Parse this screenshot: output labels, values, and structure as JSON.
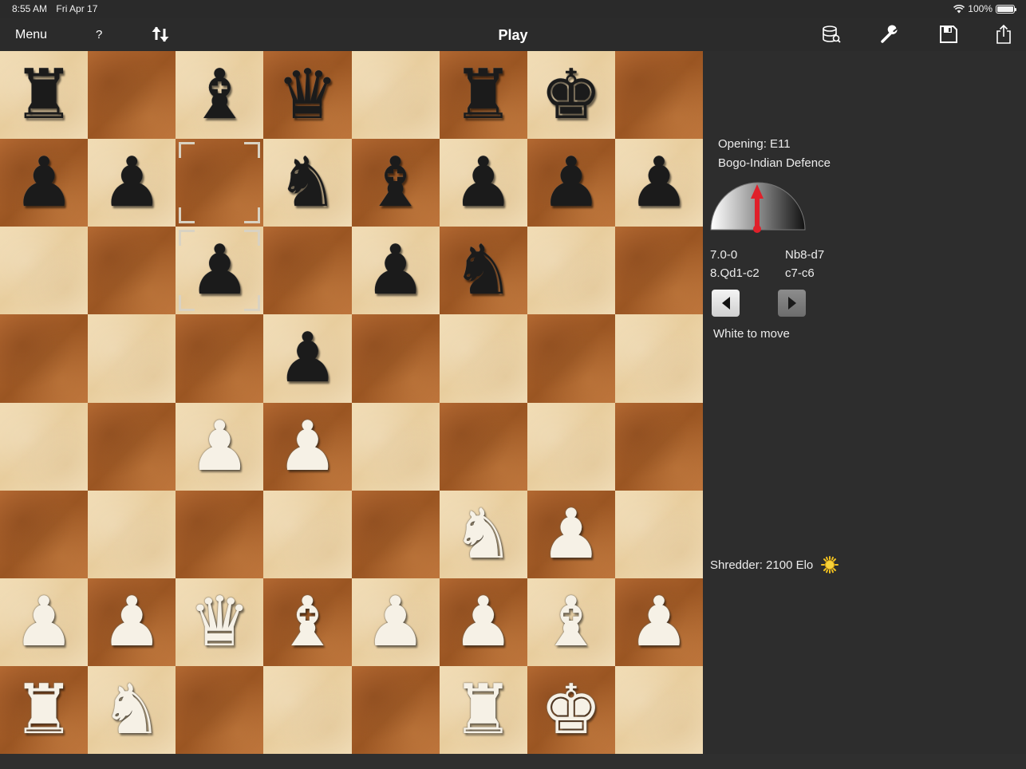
{
  "status_bar": {
    "time": "8:55 AM",
    "date": "Fri Apr 17",
    "battery": "100%"
  },
  "toolbar": {
    "menu_label": "Menu",
    "help_label": "?",
    "title": "Play",
    "icons": [
      "flip-board-icon",
      "database-icon",
      "wrench-icon",
      "save-icon",
      "share-icon"
    ]
  },
  "board": {
    "orientation": "white-bottom",
    "rows": [
      [
        "br",
        "",
        "bb",
        "bq",
        "",
        "br",
        "bk",
        ""
      ],
      [
        "bp",
        "bp",
        "",
        "bn",
        "bb",
        "bp",
        "bp",
        "bp"
      ],
      [
        "",
        "",
        "bp",
        "",
        "bp",
        "bn",
        "",
        ""
      ],
      [
        "",
        "",
        "",
        "bp",
        "",
        "",
        "",
        ""
      ],
      [
        "",
        "",
        "wp",
        "wp",
        "",
        "",
        "",
        ""
      ],
      [
        "",
        "",
        "",
        "",
        "",
        "wn",
        "wp",
        ""
      ],
      [
        "wp",
        "wp",
        "wq",
        "wb",
        "wp",
        "wp",
        "wb",
        "wp"
      ],
      [
        "wr",
        "wn",
        "",
        "",
        "",
        "wr",
        "wk",
        ""
      ]
    ],
    "last_move_squares": [
      "c7",
      "c6"
    ]
  },
  "panel": {
    "opening_line1": "Opening: E11",
    "opening_line2": "Bogo-Indian Defence",
    "moves": [
      {
        "white": "7.0-0",
        "black": "Nb8-d7"
      },
      {
        "white": "8.Qd1-c2",
        "black": "c7-c6"
      }
    ],
    "side_to_move": "White to move",
    "engine_label": "Shredder: 2100 Elo"
  },
  "colors": {
    "light_square": "#f1dcb4",
    "dark_square": "#a85e2a",
    "background": "#2d2d2d",
    "gauge_needle": "#e0202a"
  }
}
